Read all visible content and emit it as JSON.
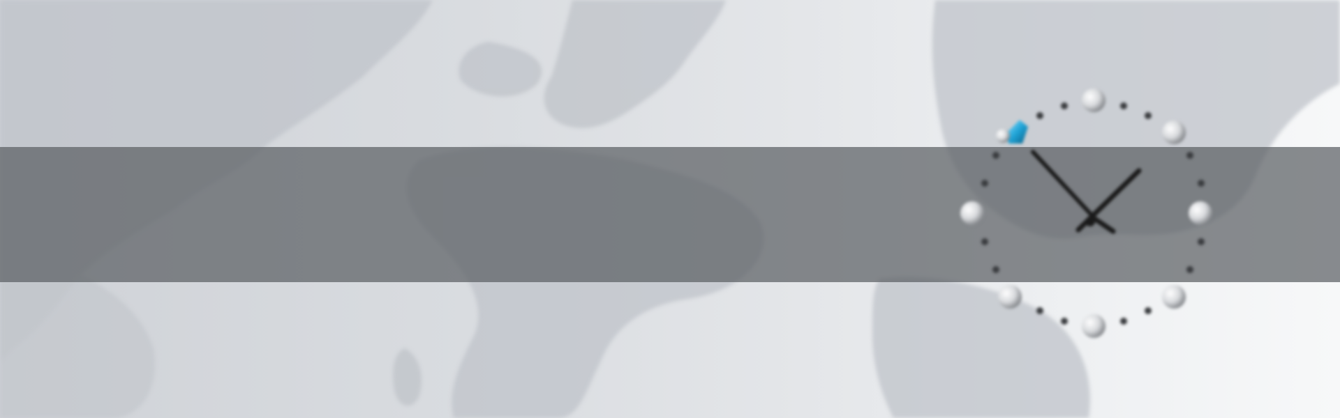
{
  "banner": {
    "band_text": "",
    "colors": {
      "background_start": "#cfd2d7",
      "background_end": "#f7f8f9",
      "continents": "#b9bdc3",
      "band": "#5c6064",
      "clock_hands": "#1a1a1a",
      "gem_accent": "#1fa3d6"
    }
  },
  "clock": {
    "time_shown": {
      "hour": 1,
      "minute": 52
    },
    "hour_marker_style": "pearl-spheres",
    "minute_marker_style": "dots",
    "icons": [
      "clock-icon",
      "gem-icon"
    ]
  }
}
